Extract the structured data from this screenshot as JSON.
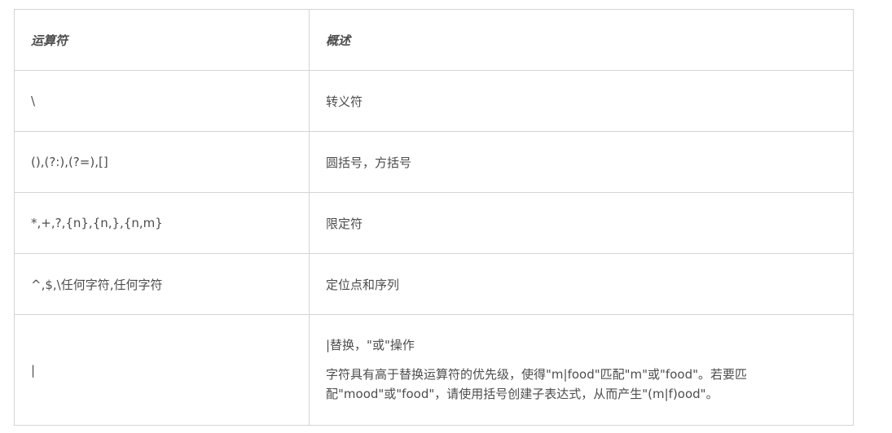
{
  "table": {
    "headers": [
      "运算符",
      "概述"
    ],
    "rows": [
      {
        "op": "\\",
        "desc": "转义符"
      },
      {
        "op": "(),(?:),(?=),[]",
        "desc": "圆括号，方括号"
      },
      {
        "op": "*,+,?,{n},{n,},{n,m}",
        "desc": "限定符"
      },
      {
        "op": "^,$,\\任何字符,任何字符",
        "desc": "定位点和序列"
      },
      {
        "op": "|",
        "desc": "|替换，\"或\"操作",
        "desc_detail": "字符具有高于替换运算符的优先级，使得\"m|food\"匹配\"m\"或\"food\"。若要匹配\"mood\"或\"food\"，请使用括号创建子表达式，从而产生\"(m|f)ood\"。"
      }
    ]
  }
}
